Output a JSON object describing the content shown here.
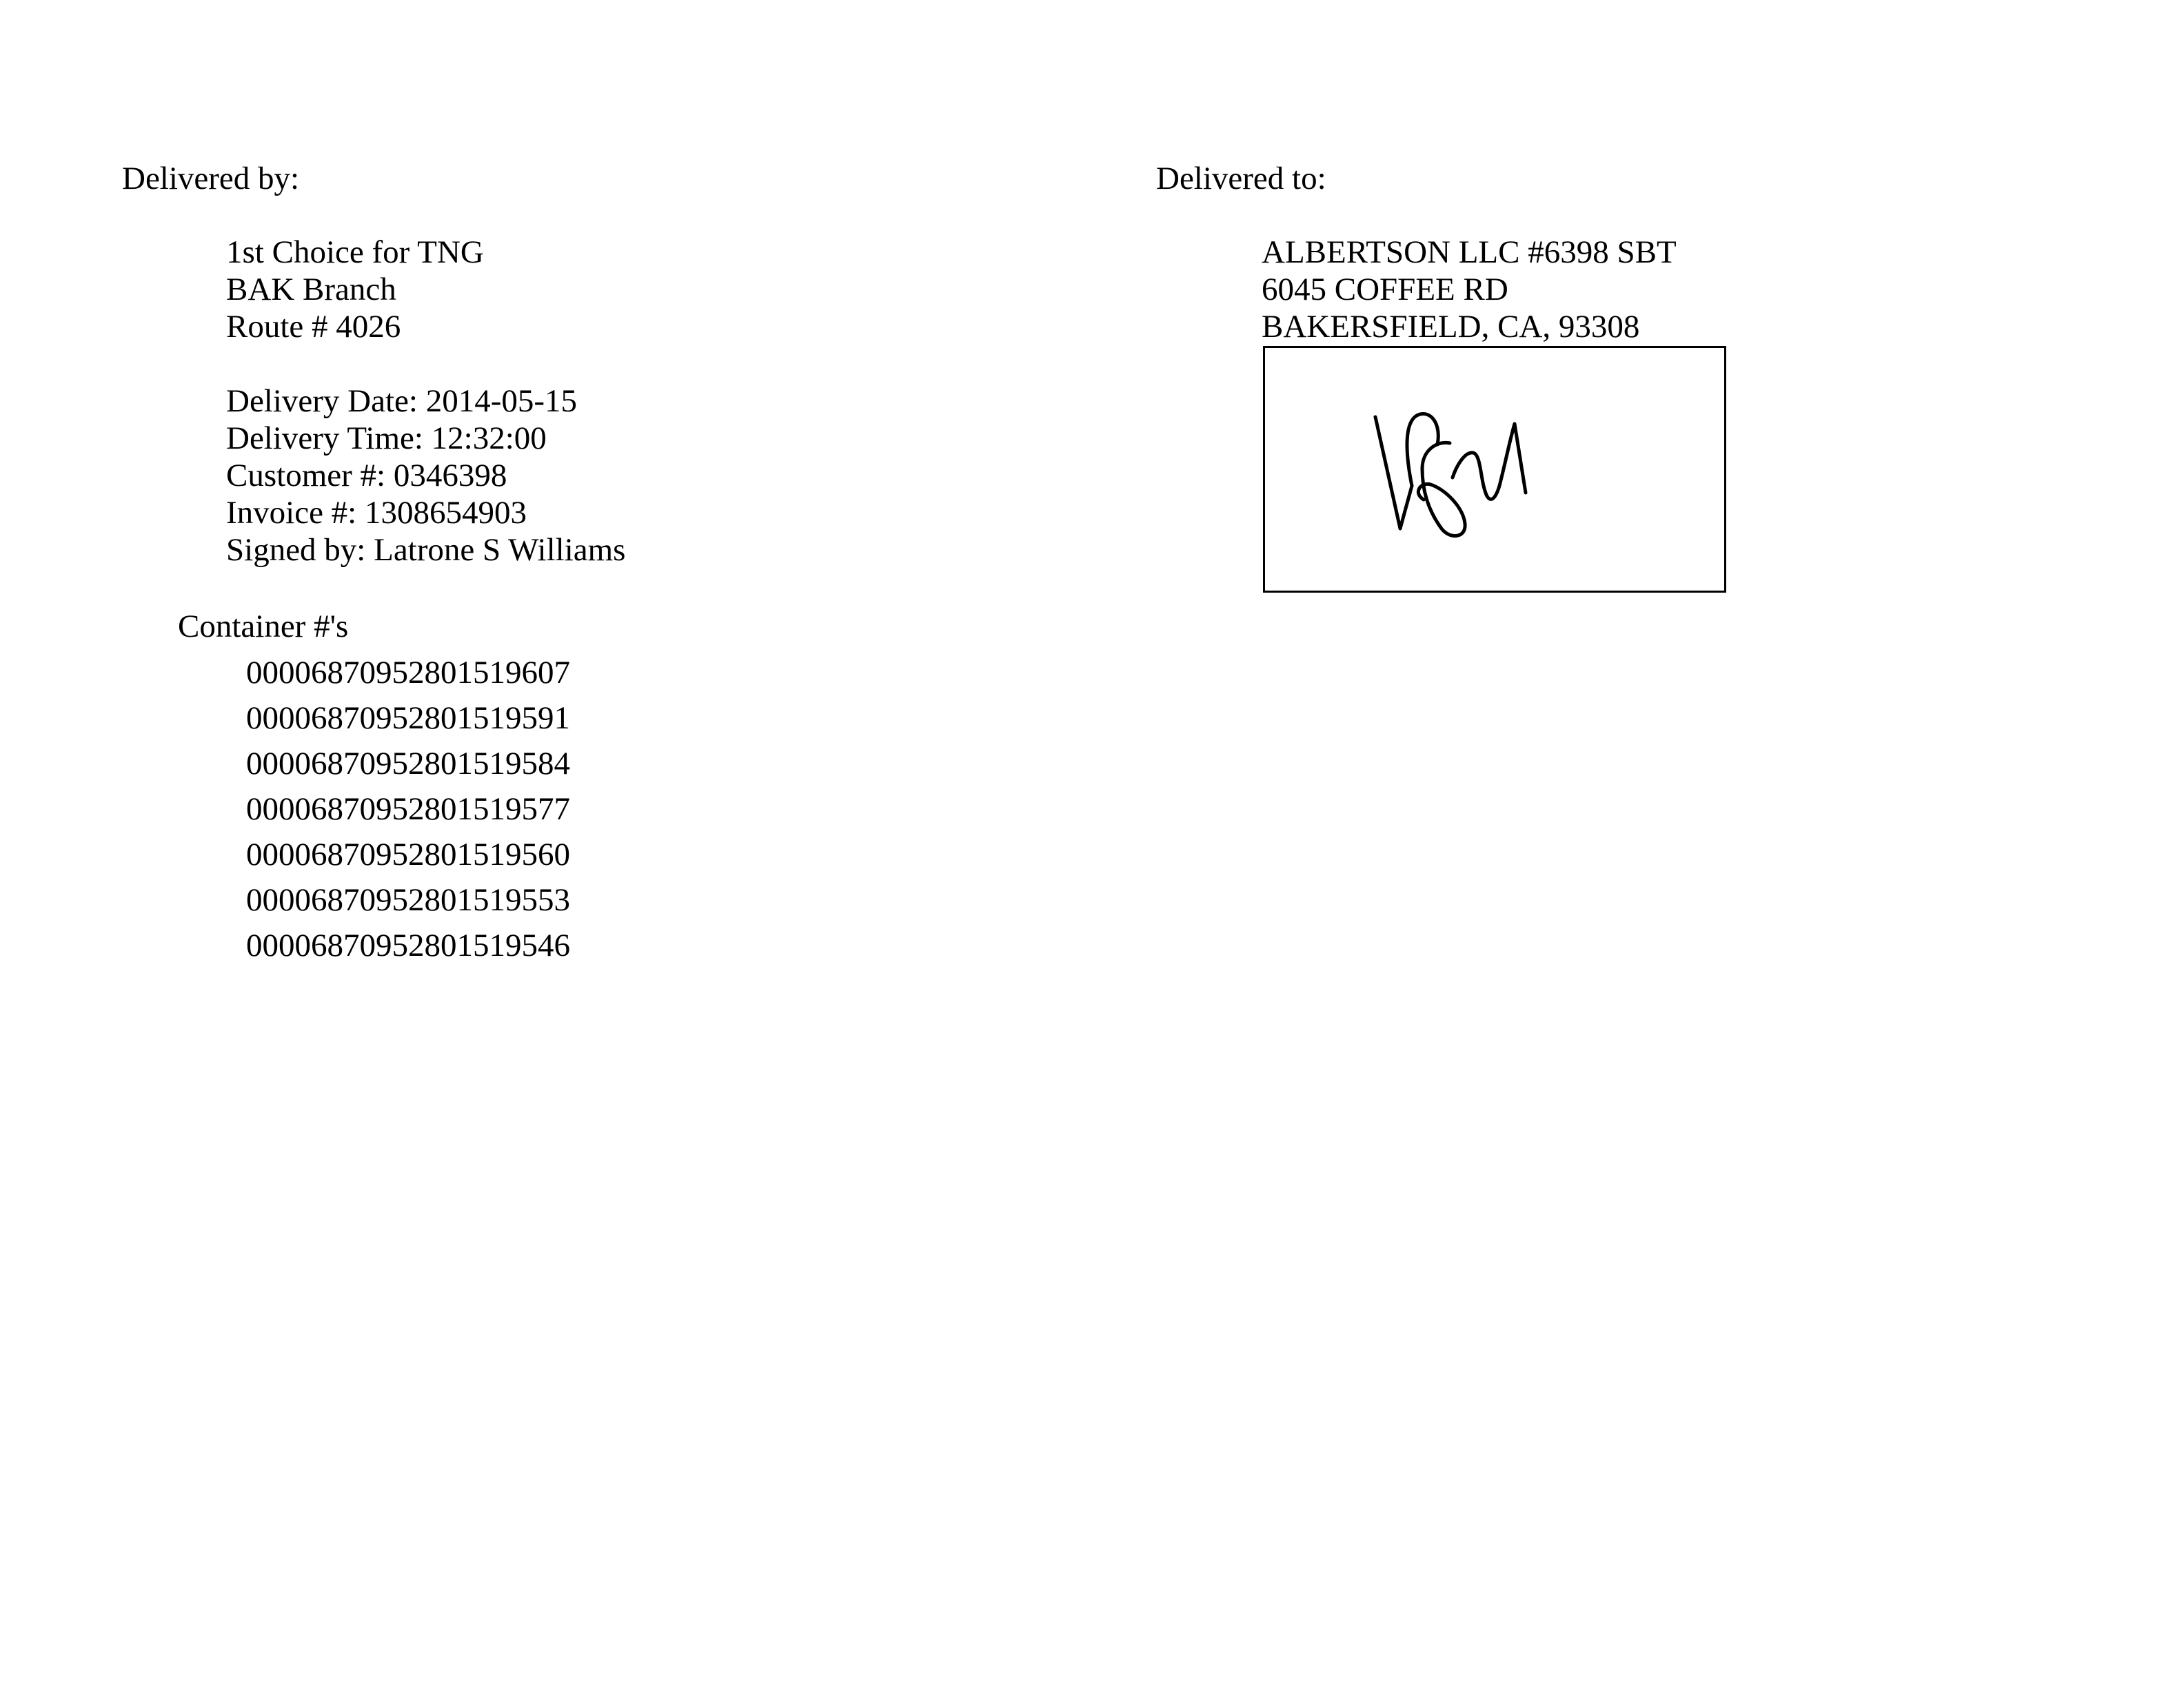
{
  "delivered_by": {
    "heading": "Delivered by:",
    "company": "1st Choice for TNG",
    "branch": "BAK Branch",
    "route": "Route # 4026",
    "delivery_date": "Delivery Date: 2014-05-15",
    "delivery_time": "Delivery Time: 12:32:00",
    "customer_number": "Customer #: 0346398",
    "invoice_number": "Invoice #: 1308654903",
    "signed_by": "Signed by: Latrone S Williams"
  },
  "containers": {
    "heading": "Container #'s",
    "items": [
      "00006870952801519607",
      "00006870952801519591",
      "00006870952801519584",
      "00006870952801519577",
      "00006870952801519560",
      "00006870952801519553",
      "00006870952801519546"
    ]
  },
  "delivered_to": {
    "heading": "Delivered to:",
    "name": "ALBERTSON LLC #6398 SBT",
    "street": "6045 COFFEE RD",
    "city_state_zip": "BAKERSFIELD, CA, 93308"
  },
  "signature": {
    "description": "handwritten signature",
    "ink_color": "#000000"
  }
}
